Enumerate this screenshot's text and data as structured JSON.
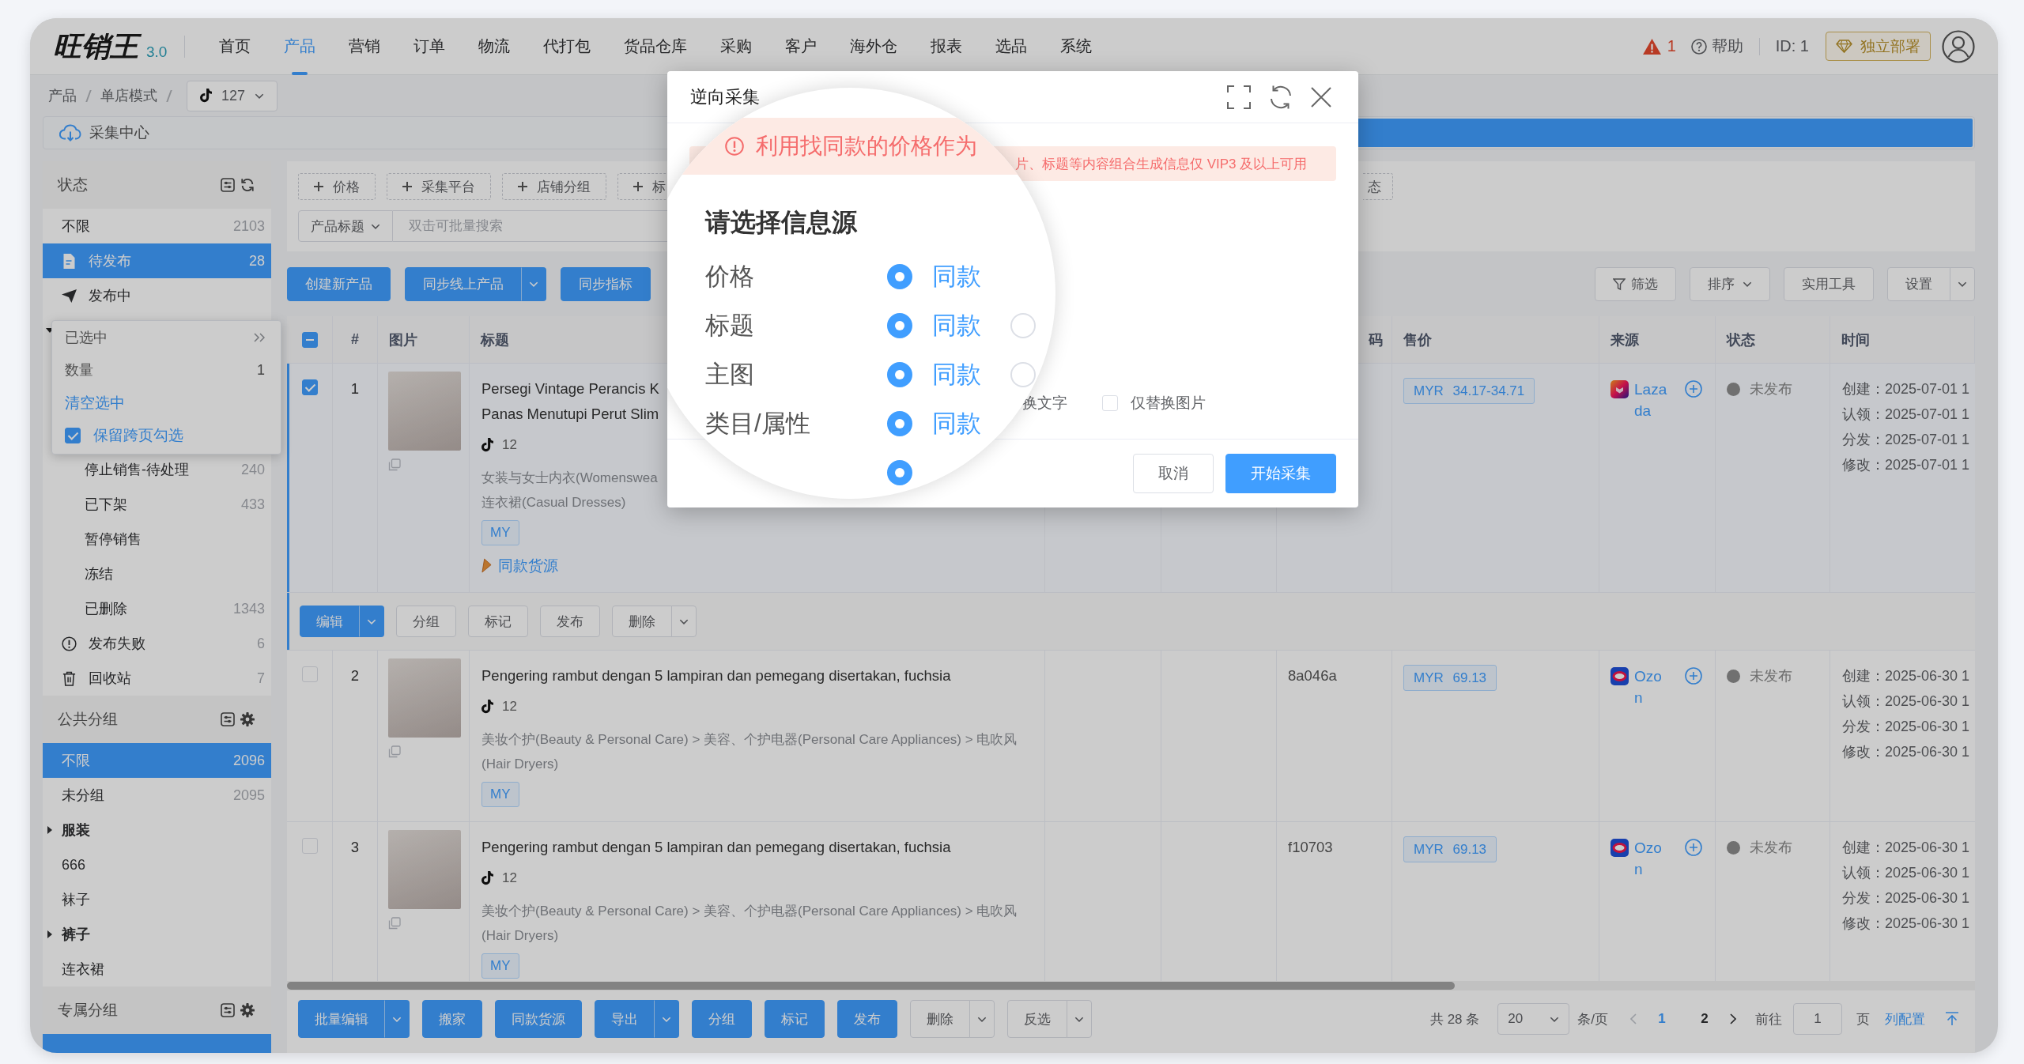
{
  "app": {
    "logo": "旺销王",
    "version": "3.0"
  },
  "nav": {
    "items": [
      {
        "label": "首页",
        "selected": false
      },
      {
        "label": "产品",
        "selected": true
      },
      {
        "label": "营销",
        "selected": false
      },
      {
        "label": "订单",
        "selected": false
      },
      {
        "label": "物流",
        "selected": false
      },
      {
        "label": "代打包",
        "selected": false
      },
      {
        "label": "货品仓库",
        "selected": false
      },
      {
        "label": "采购",
        "selected": false
      },
      {
        "label": "客户",
        "selected": false
      },
      {
        "label": "海外仓",
        "selected": false
      },
      {
        "label": "报表",
        "selected": false
      },
      {
        "label": "选品",
        "selected": false
      },
      {
        "label": "系统",
        "selected": false
      }
    ],
    "alert_count": "1",
    "help": "帮助",
    "user_id": "ID: 1",
    "deploy_button": "独立部署"
  },
  "breadcrumb": {
    "items": [
      "产品",
      "单店模式"
    ],
    "shop": "127"
  },
  "collection_bar": {
    "tab": "采集中心"
  },
  "sidebar": {
    "groups": [
      {
        "title": "状态",
        "kind": "refresh",
        "items": [
          {
            "kind": "plain",
            "label": "不限",
            "count": "2103",
            "selected": false
          },
          {
            "kind": "pending",
            "label": "待发布",
            "count": "28",
            "selected": true
          },
          {
            "kind": "publishing",
            "label": "发布中",
            "selected": false
          },
          {
            "kind": "branch",
            "expanded": true,
            "popup": {
              "title": "已选中",
              "count_label": "数量",
              "count": "1",
              "clear_link": "清空选中",
              "keep_across_pages": {
                "label": "保留跨页勾选",
                "checked": true
              }
            }
          },
          {
            "kind": "child",
            "label": "停止销售-待处理",
            "count": "240",
            "selected": false
          },
          {
            "kind": "child",
            "label": "已下架",
            "count": "433",
            "selected": false
          },
          {
            "kind": "child",
            "label": "暂停销售",
            "selected": false
          },
          {
            "kind": "child",
            "label": "冻结",
            "selected": false
          },
          {
            "kind": "child",
            "label": "已删除",
            "count": "1343",
            "selected": false
          },
          {
            "kind": "failed",
            "label": "发布失败",
            "count": "6",
            "selected": false
          },
          {
            "kind": "trash",
            "label": "回收站",
            "count": "7",
            "selected": false
          }
        ]
      },
      {
        "title": "公共分组",
        "kind": "settings",
        "items": [
          {
            "kind": "plain",
            "label": "不限",
            "count": "2096",
            "selected": true
          },
          {
            "kind": "plain",
            "label": "未分组",
            "count": "2095",
            "selected": false
          },
          {
            "kind": "branch",
            "label": "服装",
            "expanded": false,
            "selected": false
          },
          {
            "kind": "plain",
            "label": "666",
            "selected": false
          },
          {
            "kind": "plain",
            "label": "袜子",
            "selected": false
          },
          {
            "kind": "branch",
            "label": "裤子",
            "expanded": false,
            "selected": false
          },
          {
            "kind": "plain",
            "label": "连衣裙",
            "selected": false
          }
        ]
      },
      {
        "title": "专属分组",
        "kind": "settings",
        "items": [
          {
            "kind": "plain",
            "selected": true
          }
        ]
      }
    ]
  },
  "filters": {
    "tags": [
      {
        "label": "价格",
        "kind": "full"
      },
      {
        "label": "采集平台",
        "kind": "full"
      },
      {
        "label": "店铺分组",
        "kind": "full"
      },
      {
        "label": "标",
        "kind": "cut-right"
      },
      {
        "label": "态",
        "kind": "cut-left"
      }
    ],
    "field_select": "产品标题",
    "search_placeholder": "双击可批量搜索"
  },
  "toolbar": {
    "left": [
      {
        "label": "创建新产品",
        "kind": "primary"
      },
      {
        "label": "同步线上产品",
        "kind": "primary-split"
      },
      {
        "label": "同步指标",
        "kind": "primary"
      }
    ],
    "right": [
      {
        "label": "筛选",
        "kind": "filter"
      },
      {
        "label": "排序",
        "kind": "dropdown"
      },
      {
        "label": "实用工具",
        "kind": "plain"
      },
      {
        "label": "设置",
        "kind": "split"
      }
    ]
  },
  "table": {
    "select_all": {
      "partial": true
    },
    "columns": [
      "#",
      "图片",
      "标题",
      "码",
      "售价",
      "来源",
      "状态",
      "时间"
    ],
    "rows": [
      {
        "selected": true,
        "number": "1",
        "title_lines": [
          "Persegi Vintage Perancis K",
          "Panas Menutupi Perut Slim"
        ],
        "shop_count": "12",
        "category_lines": [
          "女装与女士内衣(Womenswea",
          "连衣裙(Casual Dresses)"
        ],
        "site": "MY",
        "similar_link": "同款货源",
        "price": "MYR 34.17-34.71",
        "source": {
          "kind": "lazada",
          "name": "Lazada"
        },
        "status": "未发布",
        "times": [
          "创建：2025-07-01 1",
          "认领：2025-07-01 1",
          "分发：2025-07-01 1",
          "修改：2025-07-01 1"
        ],
        "actions": [
          {
            "label": "编辑",
            "kind": "primary-split"
          },
          {
            "label": "分组",
            "kind": "plain"
          },
          {
            "label": "标记",
            "kind": "plain"
          },
          {
            "label": "发布",
            "kind": "plain"
          },
          {
            "label": "删除",
            "kind": "split"
          }
        ]
      },
      {
        "selected": false,
        "number": "2",
        "title_lines": [
          "Pengering rambut dengan 5 lampiran dan pemegang disertakan, fuchsia"
        ],
        "shop_count": "12",
        "category_lines": [
          "美妆个护(Beauty & Personal Care) > 美容、个护电器(Personal Care Appliances) > 电吹风",
          "(Hair Dryers)"
        ],
        "site": "MY",
        "code": "8a046a",
        "price": "MYR 69.13",
        "source": {
          "kind": "ozon",
          "name": "Ozon"
        },
        "status": "未发布",
        "times": [
          "创建：2025-06-30 1",
          "认领：2025-06-30 1",
          "分发：2025-06-30 1",
          "修改：2025-06-30 1"
        ]
      },
      {
        "selected": false,
        "number": "3",
        "title_lines": [
          "Pengering rambut dengan 5 lampiran dan pemegang disertakan, fuchsia"
        ],
        "shop_count": "12",
        "category_lines": [
          "美妆个护(Beauty & Personal Care) > 美容、个护电器(Personal Care Appliances) > 电吹风",
          "(Hair Dryers)"
        ],
        "site": "MY",
        "code": "f10703",
        "price": "MYR 69.13",
        "source": {
          "kind": "ozon",
          "name": "Ozon"
        },
        "status": "未发布",
        "times": [
          "创建：2025-06-30 1",
          "认领：2025-06-30 1",
          "分发：2025-06-30 1",
          "修改：2025-06-30 1"
        ]
      }
    ]
  },
  "bulk_bar": {
    "buttons": [
      {
        "label": "批量编辑",
        "kind": "primary-split"
      },
      {
        "label": "搬家",
        "kind": "primary"
      },
      {
        "label": "同款货源",
        "kind": "primary"
      },
      {
        "label": "导出",
        "kind": "primary-split"
      },
      {
        "label": "分组",
        "kind": "primary"
      },
      {
        "label": "标记",
        "kind": "primary"
      },
      {
        "label": "发布",
        "kind": "primary"
      },
      {
        "label": "删除",
        "kind": "split"
      },
      {
        "label": "反选",
        "kind": "split"
      }
    ],
    "total": "共 28 条",
    "page_size": "20",
    "page_size_unit": "条/页",
    "prev_page": {
      "disabled": true
    },
    "pages": [
      {
        "label": "1",
        "selected": true
      },
      {
        "label": "2",
        "selected": false
      }
    ],
    "next_page": {
      "disabled": false
    },
    "goto_label": "前往",
    "goto_value": "1",
    "goto_unit": "页",
    "column_config": "列配置"
  },
  "dialog": {
    "title": "逆向采集",
    "alert": "片、标题等内容组合生成信息仅 VIP3 及以上可用",
    "lens": {
      "alert": "利用找同款的价格作为",
      "heading": "请选择信息源",
      "rows": [
        {
          "label": "价格",
          "options": [
            {
              "label": "同款",
              "selected": true
            }
          ]
        },
        {
          "label": "标题",
          "options": [
            {
              "label": "同款",
              "selected": true
            },
            {
              "selected": false
            }
          ]
        },
        {
          "label": "主图",
          "options": [
            {
              "label": "同款",
              "selected": true
            },
            {
              "selected": false
            }
          ]
        },
        {
          "label": "类目/属性",
          "options": [
            {
              "label": "同款",
              "selected": true
            }
          ]
        },
        {
          "options": [
            {
              "selected": true
            }
          ]
        }
      ]
    },
    "text_option": "换文字",
    "image_only": {
      "label": "仅替换图片",
      "checked": false
    },
    "buttons": [
      {
        "label": "取消",
        "kind": "default"
      },
      {
        "label": "开始采集",
        "kind": "primary"
      }
    ]
  }
}
